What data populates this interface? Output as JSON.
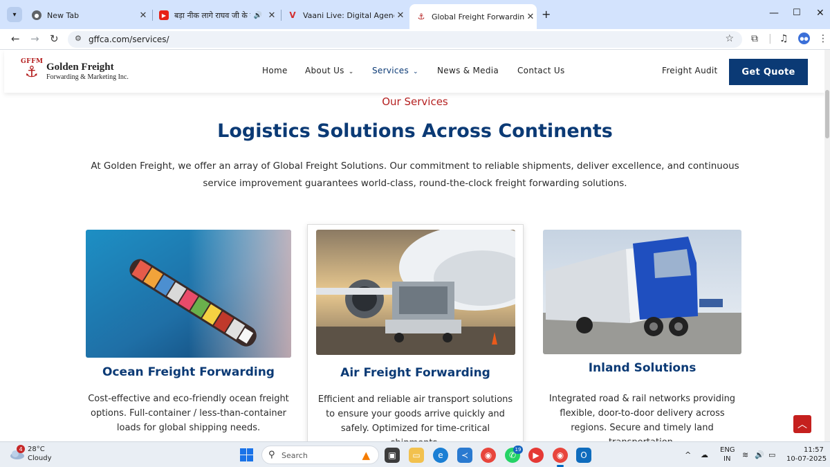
{
  "browser": {
    "tabs": [
      {
        "title": "New Tab"
      },
      {
        "title": "बड़ा नीक लागे राघव जी के गठरी"
      },
      {
        "title": "Vaani Live: Digital Agency, Web"
      },
      {
        "title": "Global Freight Forwarding Services"
      }
    ],
    "url": "gffca.com/services/"
  },
  "site": {
    "logo": {
      "monogram": "GFFM",
      "name": "Golden Freight",
      "tagline": "Forwarding & Marketing Inc."
    },
    "nav": [
      {
        "label": "Home"
      },
      {
        "label": "About Us"
      },
      {
        "label": "Services"
      },
      {
        "label": "News & Media"
      },
      {
        "label": "Contact Us"
      }
    ],
    "freight_audit": "Freight Audit",
    "cta": "Get Quote",
    "accent": "#0b3a75",
    "highlight": "#b52020"
  },
  "section": {
    "eyebrow": "Our Services",
    "headline": "Logistics Solutions Across Continents",
    "intro": "At Golden Freight, we offer an array of Global Freight Solutions. Our commitment to reliable shipments, deliver excellence, and continuous service improvement guarantees world-class, round-the-clock freight forwarding solutions."
  },
  "cards": [
    {
      "title": "Ocean Freight Forwarding",
      "image": "container-ship-photo",
      "description": "Cost-effective and eco-friendly ocean freight options. Full-container / less-than-container loads for global shipping needs."
    },
    {
      "title": "Air Freight Forwarding",
      "image": "cargo-plane-photo",
      "description": "Efficient and reliable air transport solutions to ensure your goods arrive quickly and safely. Optimized for time-critical shipments."
    },
    {
      "title": "Inland Solutions",
      "image": "truck-photo",
      "description": "Integrated road & rail networks providing flexible, door-to-door delivery across regions. Secure and timely land transportation."
    }
  ],
  "taskbar": {
    "weather": {
      "temp": "28°C",
      "condition": "Cloudy",
      "alerts": "4"
    },
    "search_placeholder": "Search",
    "badge": "19",
    "language": [
      "ENG",
      "IN"
    ],
    "time": "11:57",
    "date": "10-07-2025"
  }
}
